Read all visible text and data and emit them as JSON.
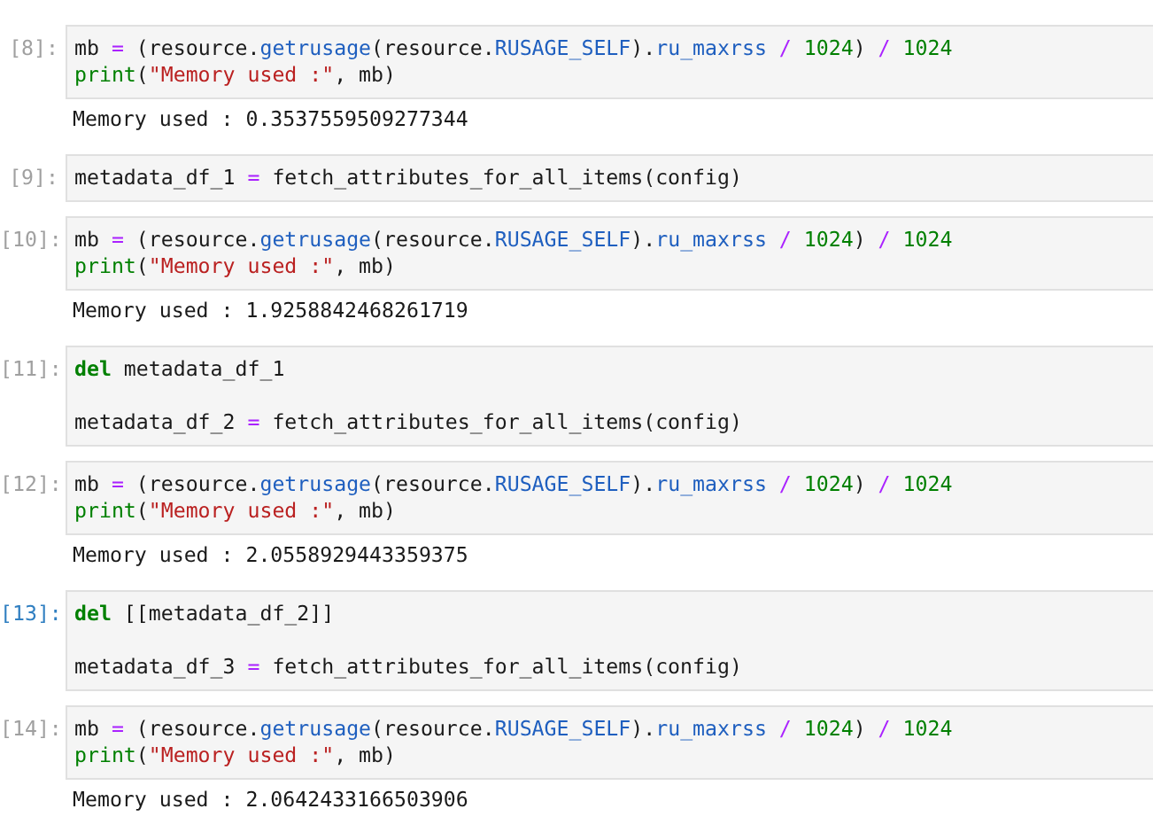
{
  "cells": [
    {
      "prompt": "[8]:",
      "selected": false,
      "blocks": [
        [
          {
            "tokens": [
              {
                "kind": "plain",
                "text": "mb "
              },
              {
                "kind": "operator",
                "text": "="
              },
              {
                "kind": "plain",
                "text": " (resource."
              },
              {
                "kind": "name",
                "text": "getrusage"
              },
              {
                "kind": "plain",
                "text": "(resource."
              },
              {
                "kind": "name",
                "text": "RUSAGE_SELF"
              },
              {
                "kind": "plain",
                "text": ")."
              },
              {
                "kind": "name",
                "text": "ru_maxrss"
              },
              {
                "kind": "operator",
                "text": " / "
              },
              {
                "kind": "number",
                "text": "1024"
              },
              {
                "kind": "plain",
                "text": ") "
              },
              {
                "kind": "operator",
                "text": "/ "
              },
              {
                "kind": "number",
                "text": "1024"
              }
            ]
          },
          {
            "tokens": [
              {
                "kind": "builtin",
                "text": "print"
              },
              {
                "kind": "plain",
                "text": "("
              },
              {
                "kind": "string",
                "text": "\"Memory used :\""
              },
              {
                "kind": "plain",
                "text": ", mb)"
              }
            ]
          }
        ]
      ],
      "output": "Memory used : 0.3537559509277344"
    },
    {
      "prompt": "[9]:",
      "selected": false,
      "blocks": [
        [
          {
            "tokens": [
              {
                "kind": "plain",
                "text": "metadata_df_1 "
              },
              {
                "kind": "operator",
                "text": "="
              },
              {
                "kind": "plain",
                "text": " fetch_attributes_for_all_items(config)"
              }
            ]
          }
        ]
      ]
    },
    {
      "prompt": "[10]:",
      "selected": false,
      "blocks": [
        [
          {
            "tokens": [
              {
                "kind": "plain",
                "text": "mb "
              },
              {
                "kind": "operator",
                "text": "="
              },
              {
                "kind": "plain",
                "text": " (resource."
              },
              {
                "kind": "name",
                "text": "getrusage"
              },
              {
                "kind": "plain",
                "text": "(resource."
              },
              {
                "kind": "name",
                "text": "RUSAGE_SELF"
              },
              {
                "kind": "plain",
                "text": ")."
              },
              {
                "kind": "name",
                "text": "ru_maxrss"
              },
              {
                "kind": "operator",
                "text": " / "
              },
              {
                "kind": "number",
                "text": "1024"
              },
              {
                "kind": "plain",
                "text": ") "
              },
              {
                "kind": "operator",
                "text": "/ "
              },
              {
                "kind": "number",
                "text": "1024"
              }
            ]
          },
          {
            "tokens": [
              {
                "kind": "builtin",
                "text": "print"
              },
              {
                "kind": "plain",
                "text": "("
              },
              {
                "kind": "string",
                "text": "\"Memory used :\""
              },
              {
                "kind": "plain",
                "text": ", mb)"
              }
            ]
          }
        ]
      ],
      "output": "Memory used : 1.9258842468261719"
    },
    {
      "prompt": "[11]:",
      "selected": false,
      "blocks": [
        [
          {
            "tokens": [
              {
                "kind": "keyword",
                "text": "del"
              },
              {
                "kind": "plain",
                "text": " metadata_df_1"
              }
            ]
          }
        ],
        [
          {
            "tokens": [
              {
                "kind": "plain",
                "text": "metadata_df_2 "
              },
              {
                "kind": "operator",
                "text": "="
              },
              {
                "kind": "plain",
                "text": " fetch_attributes_for_all_items(config)"
              }
            ]
          }
        ]
      ]
    },
    {
      "prompt": "[12]:",
      "selected": false,
      "blocks": [
        [
          {
            "tokens": [
              {
                "kind": "plain",
                "text": "mb "
              },
              {
                "kind": "operator",
                "text": "="
              },
              {
                "kind": "plain",
                "text": " (resource."
              },
              {
                "kind": "name",
                "text": "getrusage"
              },
              {
                "kind": "plain",
                "text": "(resource."
              },
              {
                "kind": "name",
                "text": "RUSAGE_SELF"
              },
              {
                "kind": "plain",
                "text": ")."
              },
              {
                "kind": "name",
                "text": "ru_maxrss"
              },
              {
                "kind": "operator",
                "text": " / "
              },
              {
                "kind": "number",
                "text": "1024"
              },
              {
                "kind": "plain",
                "text": ") "
              },
              {
                "kind": "operator",
                "text": "/ "
              },
              {
                "kind": "number",
                "text": "1024"
              }
            ]
          },
          {
            "tokens": [
              {
                "kind": "builtin",
                "text": "print"
              },
              {
                "kind": "plain",
                "text": "("
              },
              {
                "kind": "string",
                "text": "\"Memory used :\""
              },
              {
                "kind": "plain",
                "text": ", mb)"
              }
            ]
          }
        ]
      ],
      "output": "Memory used : 2.0558929443359375"
    },
    {
      "prompt": "[13]:",
      "selected": true,
      "blocks": [
        [
          {
            "tokens": [
              {
                "kind": "keyword",
                "text": "del"
              },
              {
                "kind": "plain",
                "text": " [[metadata_df_2]]"
              }
            ]
          }
        ],
        [
          {
            "tokens": [
              {
                "kind": "plain",
                "text": "metadata_df_3 "
              },
              {
                "kind": "operator",
                "text": "="
              },
              {
                "kind": "plain",
                "text": " fetch_attributes_for_all_items(config)"
              }
            ]
          }
        ]
      ]
    },
    {
      "prompt": "[14]:",
      "selected": false,
      "blocks": [
        [
          {
            "tokens": [
              {
                "kind": "plain",
                "text": "mb "
              },
              {
                "kind": "operator",
                "text": "="
              },
              {
                "kind": "plain",
                "text": " (resource."
              },
              {
                "kind": "name",
                "text": "getrusage"
              },
              {
                "kind": "plain",
                "text": "(resource."
              },
              {
                "kind": "name",
                "text": "RUSAGE_SELF"
              },
              {
                "kind": "plain",
                "text": ")."
              },
              {
                "kind": "name",
                "text": "ru_maxrss"
              },
              {
                "kind": "operator",
                "text": " / "
              },
              {
                "kind": "number",
                "text": "1024"
              },
              {
                "kind": "plain",
                "text": ") "
              },
              {
                "kind": "operator",
                "text": "/ "
              },
              {
                "kind": "number",
                "text": "1024"
              }
            ]
          },
          {
            "tokens": [
              {
                "kind": "builtin",
                "text": "print"
              },
              {
                "kind": "plain",
                "text": "("
              },
              {
                "kind": "string",
                "text": "\"Memory used :\""
              },
              {
                "kind": "plain",
                "text": ", mb)"
              }
            ]
          }
        ]
      ],
      "output": "Memory used : 2.0642433166503906"
    }
  ]
}
